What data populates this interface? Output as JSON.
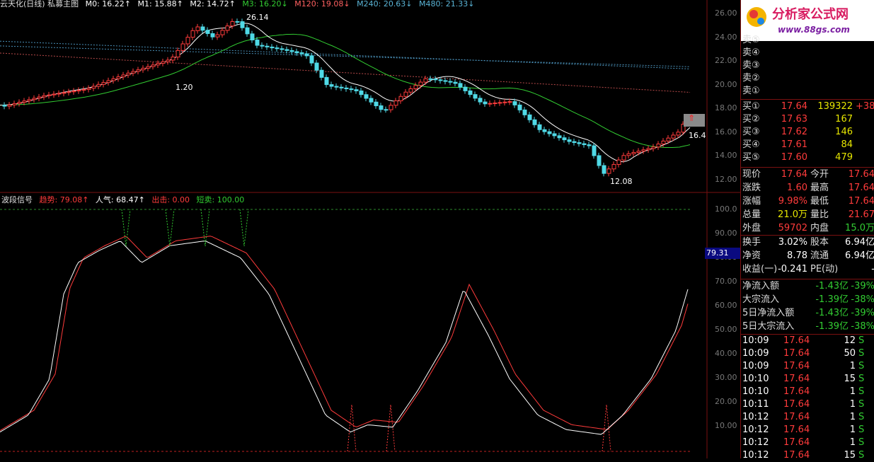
{
  "colors": {
    "up": "#ff3b3b",
    "down": "#4fd9e6",
    "yellow": "#e6e600",
    "green": "#32cd32",
    "white": "#ffffff",
    "grid": "#7a1010"
  },
  "main_header": {
    "title": "云天化(日线) 私募主图",
    "m0": "M0: 16.22↑",
    "m1": "M1: 15.88↑",
    "m2": "M2: 14.72↑",
    "m3": "M3: 16.20↓",
    "m120": "M120: 19.08↓",
    "m240": "M240: 20.63↓",
    "m480": "M480: 21.33↓"
  },
  "price_axis": [
    "26.00",
    "24.00",
    "22.00",
    "20.00",
    "18.00",
    "16.00",
    "14.00",
    "12.00"
  ],
  "annotations": {
    "high": "26.14",
    "low": "12.08",
    "mark": "1.20",
    "last": "16.4"
  },
  "indicator_header": {
    "name": "波段信号",
    "trend": "趋势: 79.08↑",
    "pop": "人气: 68.47↑",
    "out": "出击: 0.00",
    "short": "短卖: 100.00"
  },
  "indicator_axis": [
    "100.0",
    "90.00",
    "80.00",
    "70.00",
    "60.00",
    "50.00",
    "40.00",
    "30.00",
    "20.00",
    "10.00"
  ],
  "indicator_tag": "79.31",
  "logo": {
    "name": "分析家公式网",
    "url": "www.88gs.com"
  },
  "sell_levels": [
    "卖⑤",
    "卖④",
    "卖③",
    "卖②",
    "卖①"
  ],
  "buy_levels": [
    {
      "label": "买①",
      "price": "17.64",
      "vol": "139322",
      "extra": "+38"
    },
    {
      "label": "买②",
      "price": "17.63",
      "vol": "167",
      "extra": ""
    },
    {
      "label": "买③",
      "price": "17.62",
      "vol": "146",
      "extra": ""
    },
    {
      "label": "买④",
      "price": "17.61",
      "vol": "84",
      "extra": ""
    },
    {
      "label": "买⑤",
      "price": "17.60",
      "vol": "479",
      "extra": ""
    }
  ],
  "quote": [
    {
      "l1": "现价",
      "v1": "17.64",
      "l2": "今开",
      "v2": "17.64"
    },
    {
      "l1": "涨跌",
      "v1": "1.60",
      "l2": "最高",
      "v2": "17.64"
    },
    {
      "l1": "涨幅",
      "v1": "9.98%",
      "l2": "最低",
      "v2": "17.64"
    },
    {
      "l1": "总量",
      "v1": "21.0万",
      "l2": "量比",
      "v2": "21.67"
    },
    {
      "l1": "外盘",
      "v1": "59702",
      "l2": "内盘",
      "v2": "15.0万"
    }
  ],
  "fundamentals": [
    {
      "l1": "换手",
      "v1": "3.02%",
      "l2": "股本",
      "v2": "6.94亿"
    },
    {
      "l1": "净资",
      "v1": "8.78",
      "l2": "流通",
      "v2": "6.94亿"
    },
    {
      "l1": "收益(一)",
      "v1": "-0.241",
      "l2": "PE(动)",
      "v2": "-"
    }
  ],
  "flows": [
    {
      "label": "净流入额",
      "value": "-1.43亿",
      "pct": "-39%"
    },
    {
      "label": "大宗流入",
      "value": "-1.39亿",
      "pct": "-38%"
    },
    {
      "label": "5日净流入额",
      "value": "-1.43亿",
      "pct": "-39%"
    },
    {
      "label": "5日大宗流入",
      "value": "-1.39亿",
      "pct": "-38%"
    }
  ],
  "ticks": [
    {
      "time": "10:09",
      "price": "17.64",
      "vol": "12",
      "side": "S"
    },
    {
      "time": "10:09",
      "price": "17.64",
      "vol": "50",
      "side": "S"
    },
    {
      "time": "10:09",
      "price": "17.64",
      "vol": "1",
      "side": "S"
    },
    {
      "time": "10:10",
      "price": "17.64",
      "vol": "15",
      "side": "S"
    },
    {
      "time": "10:10",
      "price": "17.64",
      "vol": "1",
      "side": "S"
    },
    {
      "time": "10:11",
      "price": "17.64",
      "vol": "1",
      "side": "S"
    },
    {
      "time": "10:12",
      "price": "17.64",
      "vol": "1",
      "side": "S"
    },
    {
      "time": "10:12",
      "price": "17.64",
      "vol": "1",
      "side": "S"
    },
    {
      "time": "10:12",
      "price": "17.64",
      "vol": "1",
      "side": "S"
    },
    {
      "time": "10:12",
      "price": "17.64",
      "vol": "15",
      "side": "S"
    }
  ]
}
